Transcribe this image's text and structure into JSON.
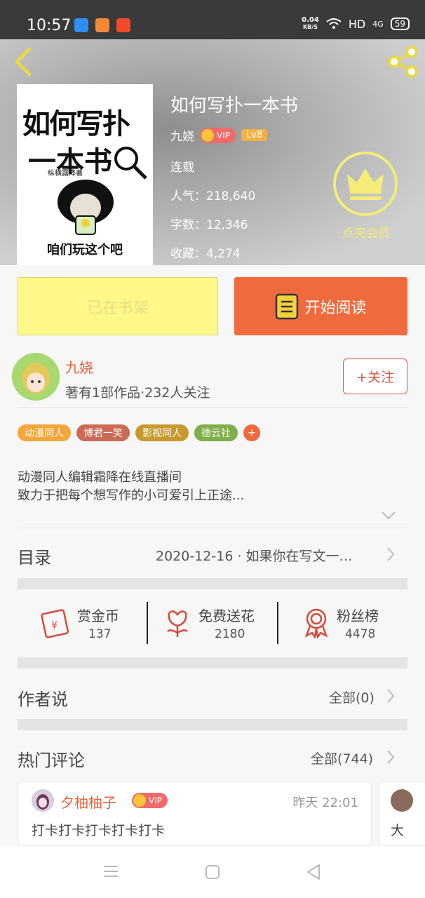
{
  "status_bar": {
    "time": "10:57",
    "speed_value": "0.04",
    "speed_unit": "KB/S",
    "network": "HD",
    "signal": "4G",
    "battery": "59"
  },
  "book": {
    "title": "如何写扑一本书",
    "author": "九娆",
    "vip_label": "VIP",
    "level": "Lv8",
    "status": "连载",
    "popularity": "人气：218,640",
    "word_count": "字数：12,346",
    "favorites": "收藏：4,274",
    "cover": {
      "title_line1": "如何写扑",
      "title_line2": "一本书",
      "subtitle": "纵横露降著",
      "caption": "咱们玩这个吧"
    }
  },
  "membership": {
    "label": "点亮会员"
  },
  "actions": {
    "shelf_label": "已在书架",
    "read_label": "开始阅读"
  },
  "author_card": {
    "name": "九娆",
    "info": "著有1部作品·232人关注",
    "follow_label": "+关注"
  },
  "tags": [
    {
      "label": "动漫同人",
      "color": "#f4a63a"
    },
    {
      "label": "博君一笑",
      "color": "#c96b55"
    },
    {
      "label": "影视同人",
      "color": "#c89a2e"
    },
    {
      "label": "德云社",
      "color": "#7fae4a"
    }
  ],
  "tag_more": "+",
  "description": {
    "line1": "动漫同人编辑霜降在线直播间",
    "line2": "致力于把每个想写作的小可爱引上正途..."
  },
  "catalog": {
    "label": "目录",
    "latest": "2020-12-16 · 如果你在写文一…"
  },
  "stats": [
    {
      "label": "赏金币",
      "value": "137"
    },
    {
      "label": "免费送花",
      "value": "2180"
    },
    {
      "label": "粉丝榜",
      "value": "4478"
    }
  ],
  "author_says": {
    "label": "作者说",
    "all": "全部(0)"
  },
  "hot_comments": {
    "label": "热门评论",
    "all": "全部(744)",
    "first": {
      "user": "夕柚柚子",
      "vip": "VIP",
      "time": "昨天 22:01",
      "text": "打卡打卡打卡打卡打卡"
    },
    "second_text": "大"
  },
  "colors": {
    "accent": "#ef6b3d",
    "shelf": "#fff98a",
    "gold": "#f4ec77"
  }
}
